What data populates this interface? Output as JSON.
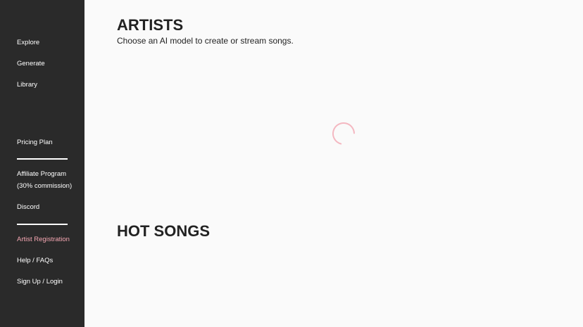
{
  "sidebar": {
    "nav": {
      "explore": "Explore",
      "generate": "Generate",
      "library": "Library"
    },
    "pricing_plan": "Pricing Plan",
    "affiliate_program_line1": "Affiliate Program",
    "affiliate_program_line2": "(30% commission)",
    "discord": "Discord",
    "artist_registration": "Artist Registration",
    "help_faqs": "Help / FAQs",
    "sign_up_login": "Sign Up / Login"
  },
  "main": {
    "artists_title": "ARTISTS",
    "artists_subtitle": "Choose an AI model to create or stream songs.",
    "hot_songs_title": "HOT SONGS"
  },
  "colors": {
    "sidebar_bg": "#2a2a2a",
    "accent": "#f4a6b2",
    "spinner": "#f4b8c1",
    "page_bg": "#fafafa"
  },
  "icons": {
    "loading": "loading-spinner-icon"
  }
}
